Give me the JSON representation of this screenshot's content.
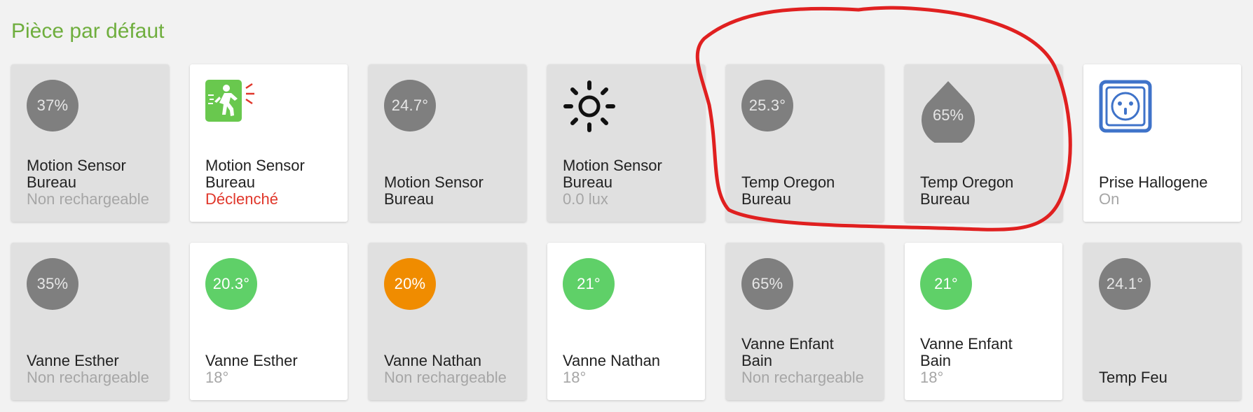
{
  "room": {
    "title": "Pièce par défaut"
  },
  "tiles": [
    {
      "circle": "37%",
      "name": "Motion Sensor Bureau",
      "status": "Non rechargeable"
    },
    {
      "name": "Motion Sensor Bureau",
      "status": "Déclenché"
    },
    {
      "circle": "24.7°",
      "name": "Motion Sensor Bureau"
    },
    {
      "name": "Motion Sensor Bureau",
      "status": "0.0 lux"
    },
    {
      "circle": "25.3°",
      "name": "Temp Oregon Bureau"
    },
    {
      "drop": "65%",
      "name": "Temp Oregon Bureau"
    },
    {
      "name": "Prise Hallogene",
      "status": "On"
    },
    {
      "circle": "35%",
      "name": "Vanne Esther",
      "status": "Non rechargeable"
    },
    {
      "circle": "20.3°",
      "name": "Vanne Esther",
      "status": "18°"
    },
    {
      "circle": "20%",
      "name": "Vanne Nathan",
      "status": "Non rechargeable"
    },
    {
      "circle": "21°",
      "name": "Vanne Nathan",
      "status": "18°"
    },
    {
      "circle": "65%",
      "name": "Vanne Enfant Bain",
      "status": "Non rechargeable"
    },
    {
      "circle": "21°",
      "name": "Vanne Enfant Bain",
      "status": "18°"
    },
    {
      "circle": "24.1°",
      "name": "Temp Feu"
    }
  ],
  "icons": {
    "motion": "motion-detected-icon",
    "sun": "sun-icon",
    "drop": "water-drop-icon",
    "outlet": "power-outlet-icon"
  },
  "colors": {
    "room_title": "#6fae3e",
    "tile_off": "#e0e0e0",
    "tile_on": "#ffffff",
    "circle_grey": "#7f7f7f",
    "circle_green": "#5fd068",
    "circle_orange": "#f08c00",
    "alert": "#e0362a",
    "annotation": "#e02020"
  }
}
